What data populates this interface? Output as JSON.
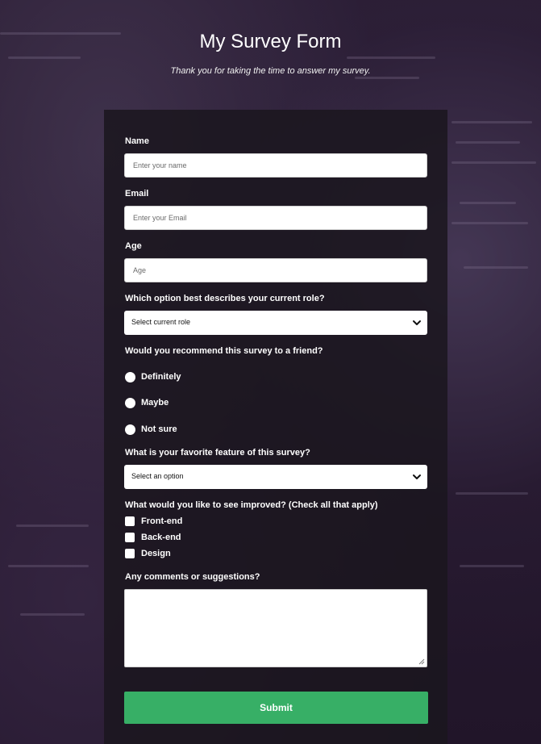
{
  "header": {
    "title": "My Survey Form",
    "description": "Thank you for taking the time to answer my survey."
  },
  "form": {
    "name": {
      "label": "Name",
      "placeholder": "Enter your name",
      "value": ""
    },
    "email": {
      "label": "Email",
      "placeholder": "Enter your Email",
      "value": ""
    },
    "age": {
      "label": "Age",
      "placeholder": "Age",
      "value": ""
    },
    "role": {
      "label": "Which option best describes your current role?",
      "selected": "Select current role",
      "icon": "chevron-down-icon"
    },
    "recommend": {
      "label": "Would you recommend this survey to a friend?",
      "options": [
        "Definitely",
        "Maybe",
        "Not sure"
      ]
    },
    "feature": {
      "label": "What is your favorite feature of this survey?",
      "selected": "Select an option",
      "icon": "chevron-down-icon"
    },
    "improve": {
      "label": "What would you like to see improved? (Check all that apply)",
      "options": [
        "Front-end",
        "Back-end",
        "Design"
      ]
    },
    "comments": {
      "label": "Any comments or suggestions?",
      "value": ""
    },
    "submit_label": "Submit"
  },
  "colors": {
    "submit": "#37af66",
    "card": "#1b161e",
    "text": "#ffffff"
  }
}
